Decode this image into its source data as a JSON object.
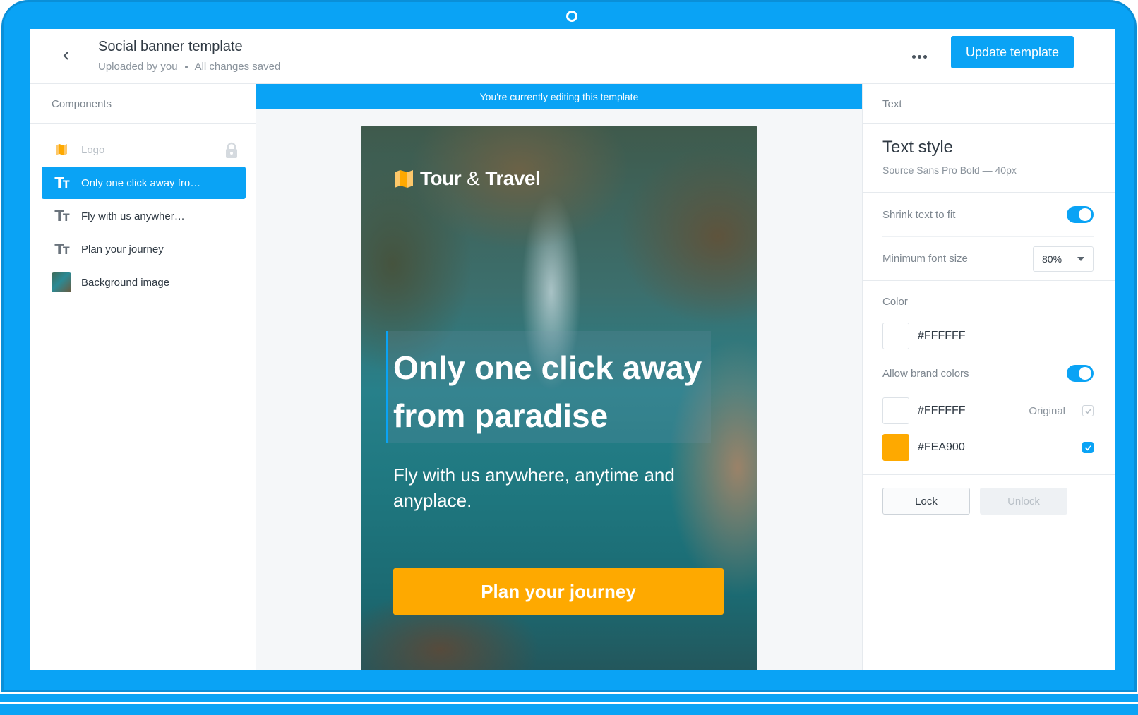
{
  "header": {
    "title": "Social banner template",
    "uploaded_by": "Uploaded by you",
    "save_status": "All changes saved",
    "update_button": "Update template",
    "back_icon": "chevron-left-icon",
    "more_icon": "more-horizontal-icon"
  },
  "components": {
    "heading": "Components",
    "items": [
      {
        "label": "Logo",
        "icon": "logo-icon",
        "state": "locked"
      },
      {
        "label": "Only one click away fro…",
        "icon": "text-icon",
        "state": "selected"
      },
      {
        "label": "Fly with us anywher…",
        "icon": "text-icon",
        "state": "default"
      },
      {
        "label": "Plan your journey",
        "icon": "text-icon",
        "state": "default"
      },
      {
        "label": "Background image",
        "icon": "image-thumbnail",
        "state": "default"
      }
    ]
  },
  "canvas": {
    "editing_notice": "You're currently editing this template",
    "logo_text_1": "Tour",
    "logo_amp": "&",
    "logo_text_2": "Travel",
    "headline": "Only one click away from paradise",
    "subline": "Fly with us anywhere, anytime and anyplace.",
    "cta": "Plan your journey"
  },
  "properties": {
    "heading": "Text",
    "style_title": "Text style",
    "style_font": "Source Sans Pro Bold — 40px",
    "shrink_label": "Shrink text to fit",
    "shrink_on": true,
    "min_font_label": "Minimum font size",
    "min_font_value": "80%",
    "color_label": "Color",
    "color_value": "#FFFFFF",
    "brand_label": "Allow brand colors",
    "brand_on": true,
    "brand_colors": [
      {
        "hex": "#FFFFFF",
        "note": "Original",
        "checked": true
      },
      {
        "hex": "#FEA900",
        "note": "",
        "checked": true
      }
    ],
    "lock_button": "Lock",
    "unlock_button": "Unlock"
  },
  "colors": {
    "accent": "#0AA3F5",
    "brand_orange": "#FEA900"
  }
}
